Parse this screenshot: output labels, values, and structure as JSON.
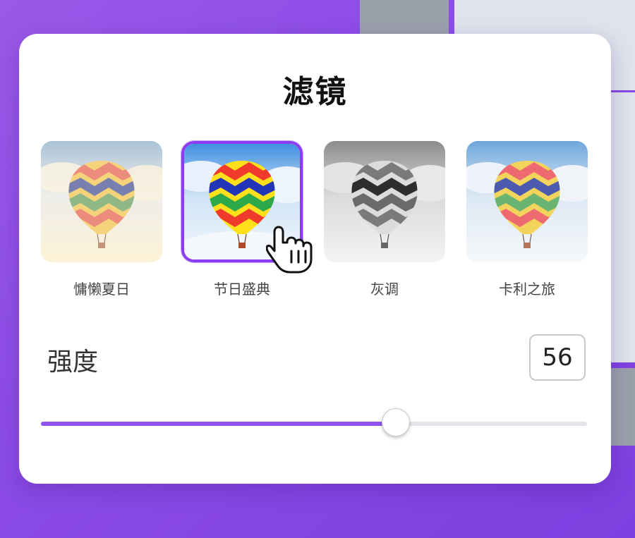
{
  "title": "滤镜",
  "filters": [
    {
      "label": "慵懒夏日",
      "selected": false
    },
    {
      "label": "节日盛典",
      "selected": true
    },
    {
      "label": "灰调",
      "selected": false
    },
    {
      "label": "卡利之旅",
      "selected": false
    }
  ],
  "intensity": {
    "label": "强度",
    "value": "56",
    "level_percent": 65
  },
  "colors": {
    "accent": "#8b3cf0",
    "background": "#8c4be6"
  },
  "icons": {
    "cursor": "hand-pointer-icon"
  }
}
